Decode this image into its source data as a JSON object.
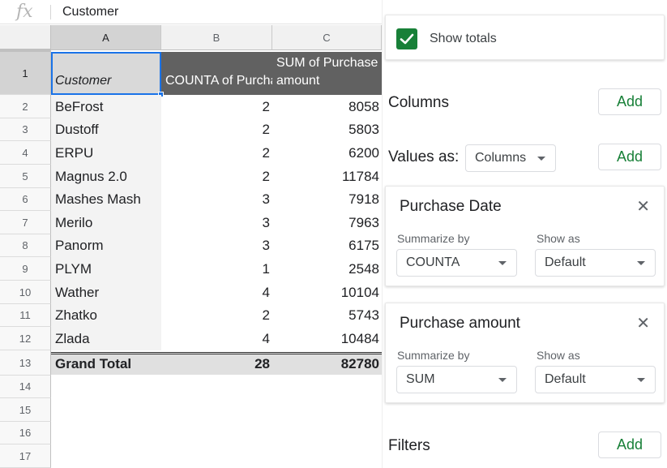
{
  "formula_bar": {
    "icon": "fx",
    "value": "Customer"
  },
  "columns": [
    "A",
    "B",
    "C"
  ],
  "row_numbers": [
    "1",
    "2",
    "3",
    "4",
    "5",
    "6",
    "7",
    "8",
    "9",
    "10",
    "11",
    "12",
    "13",
    "14",
    "15",
    "16",
    "17"
  ],
  "pivot": {
    "a1": "Customer",
    "col_b_header": "COUNTA of Purchase Date",
    "col_c_header_line1": "SUM of Purchase",
    "col_c_header_line2": "amount",
    "rows": [
      {
        "customer": "BeFrost",
        "count": "2",
        "sum": "8058"
      },
      {
        "customer": "Dustoff",
        "count": "2",
        "sum": "5803"
      },
      {
        "customer": "ERPU",
        "count": "2",
        "sum": "6200"
      },
      {
        "customer": "Magnus 2.0",
        "count": "2",
        "sum": "11784"
      },
      {
        "customer": "Mashes Mash",
        "count": "3",
        "sum": "7918"
      },
      {
        "customer": "Merilo",
        "count": "3",
        "sum": "7963"
      },
      {
        "customer": "Panorm",
        "count": "3",
        "sum": "6175"
      },
      {
        "customer": "PLYM",
        "count": "1",
        "sum": "2548"
      },
      {
        "customer": "Wather",
        "count": "4",
        "sum": "10104"
      },
      {
        "customer": "Zhatko",
        "count": "2",
        "sum": "5743"
      },
      {
        "customer": "Zlada",
        "count": "4",
        "sum": "10484"
      }
    ],
    "total": {
      "label": "Grand Total",
      "count": "28",
      "sum": "82780"
    }
  },
  "editor": {
    "show_totals_label": "Show totals",
    "show_totals_checked": true,
    "columns_label": "Columns",
    "add_label": "Add",
    "values_as_label": "Values as:",
    "values_as_value": "Columns",
    "value_cards": [
      {
        "title": "Purchase Date",
        "summarize_label": "Summarize by",
        "summarize_value": "COUNTA",
        "show_as_label": "Show as",
        "show_as_value": "Default"
      },
      {
        "title": "Purchase amount",
        "summarize_label": "Summarize by",
        "summarize_value": "SUM",
        "show_as_label": "Show as",
        "show_as_value": "Default"
      }
    ],
    "filters_label": "Filters",
    "close_glyph": "✕"
  },
  "colors": {
    "accent_green": "#188038",
    "selection_blue": "#1a73e8",
    "header_dark": "#616161"
  }
}
